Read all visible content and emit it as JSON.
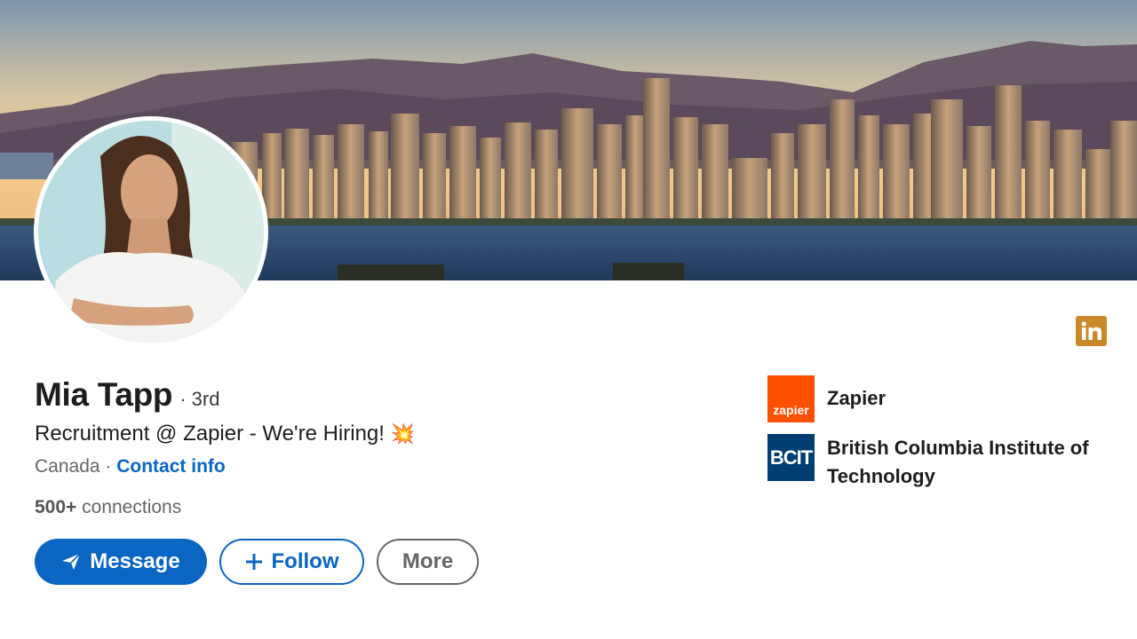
{
  "profile": {
    "name": "Mia Tapp",
    "degree": "· 3rd",
    "headline": "Recruitment @ Zapier - We're Hiring!",
    "headline_emoji": "💥",
    "location": "Canada",
    "separator": " · ",
    "contact_info": "Contact info",
    "connections_count": "500+",
    "connections_label": " connections"
  },
  "actions": {
    "message_label": "Message",
    "follow_label": "Follow",
    "more_label": "More"
  },
  "orgs": [
    {
      "name": "Zapier",
      "logo_text": "zapier",
      "logo_color": "#ff4f00"
    },
    {
      "name": "British Columbia Institute of Technology",
      "logo_text": "BCIT",
      "logo_color": "#003e74"
    }
  ],
  "badge": {
    "icon": "linkedin-icon",
    "text": "in",
    "color": "#c9892b"
  },
  "colors": {
    "accent": "#0a66c2",
    "muted": "#666666"
  },
  "icons": {
    "message": "send-icon",
    "follow": "plus-icon"
  }
}
